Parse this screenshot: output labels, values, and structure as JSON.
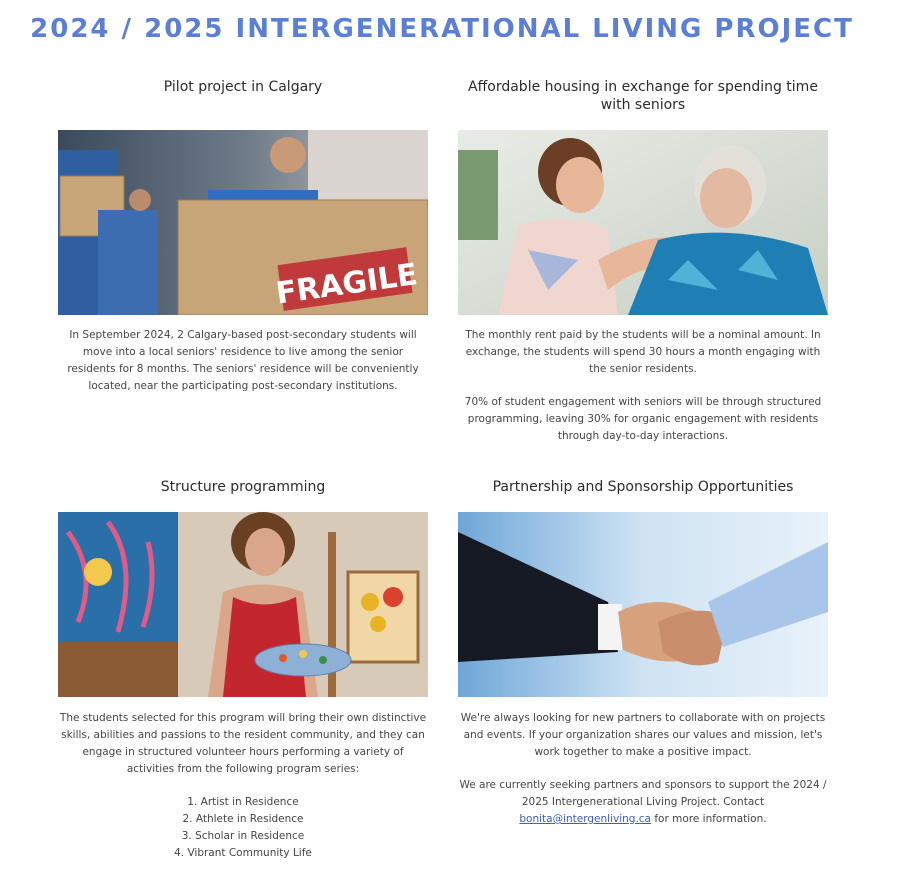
{
  "page": {
    "title": "2024 / 2025 INTERGENERATIONAL LIVING PROJECT"
  },
  "cards": [
    {
      "heading": "Pilot project in Calgary",
      "image_label": "FRAGILE",
      "paragraphs": [
        "In September 2024, 2 Calgary-based post-secondary students will move into a local seniors' residence to live among the senior residents for 8 months. The seniors' residence will be conveniently located, near the participating post-secondary institutions."
      ]
    },
    {
      "heading": "Affordable housing in exchange for spending time with seniors",
      "paragraphs": [
        "The monthly rent paid by the students will be a nominal amount. In exchange, the students will spend 30 hours a month engaging with the senior residents.",
        "70% of student engagement with seniors will be through structured programming, leaving 30% for organic engagement with residents through day-to-day interactions."
      ]
    },
    {
      "heading": "Structure programming",
      "paragraphs": [
        "The students selected for this program will bring their own distinctive skills, abilities and passions to the resident community, and they can engage in structured volunteer hours performing a variety of activities from the following program series:"
      ],
      "list": [
        "1. Artist in Residence",
        "2. Athlete in Residence",
        "3. Scholar in Residence",
        "4. Vibrant Community Life"
      ]
    },
    {
      "heading": "Partnership and Sponsorship Opportunities",
      "paragraphs": [
        "We're always looking for new partners to collaborate with on projects and events. If your organization shares our values and mission, let's work together to make a positive impact."
      ],
      "contact": {
        "before": "We are currently seeking partners and sponsors to support the 2024 / 2025 Intergenerational Living Project. Contact ",
        "email": "bonita@intergenliving.ca",
        "after": " for more information."
      }
    }
  ],
  "colors": {
    "title": "#5b7fd6",
    "link": "#3a5fb8"
  }
}
